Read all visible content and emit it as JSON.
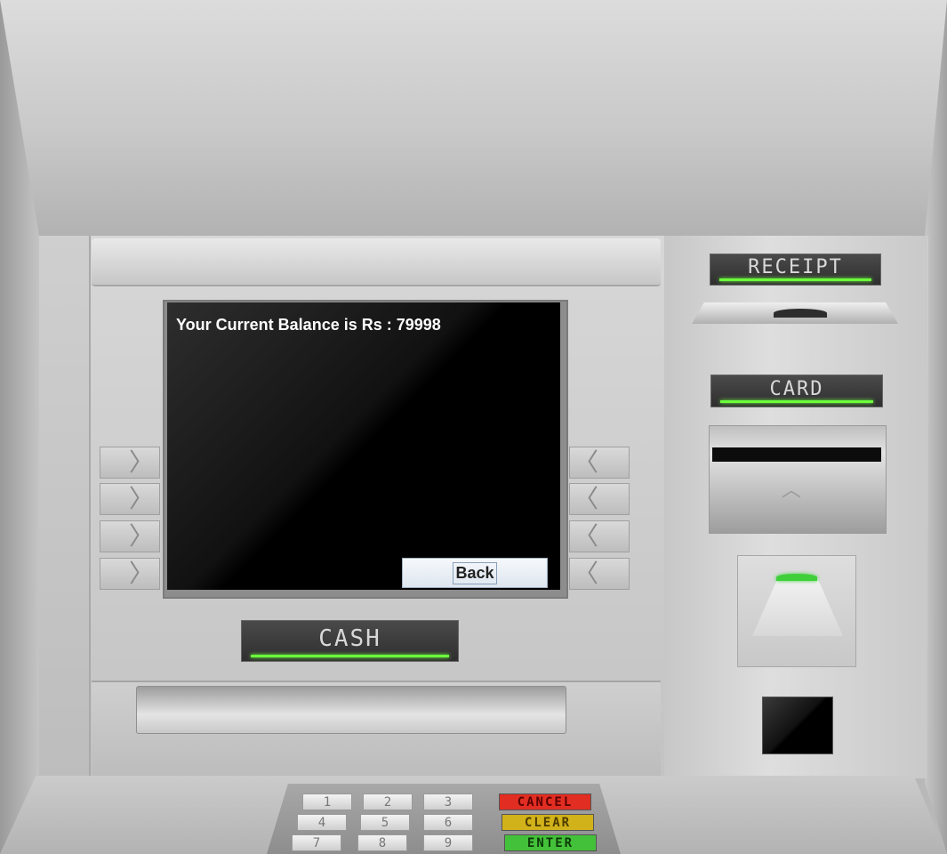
{
  "screen": {
    "balance_text": "Your Current Balance is Rs : 79998",
    "back_label": "Back"
  },
  "labels": {
    "receipt": "RECEIPT",
    "card": "CARD",
    "cash": "CASH"
  },
  "side_keys": {
    "left_glyph": "〉",
    "right_glyph": "〈"
  },
  "keypad": {
    "numbers": [
      "1",
      "2",
      "3",
      "4",
      "5",
      "6",
      "7",
      "8",
      "9"
    ],
    "cancel": "CANCEL",
    "clear": "CLEAR",
    "enter": "ENTER"
  },
  "colors": {
    "indicator_green": "#6cff3c",
    "cancel": "#e22d22",
    "clear": "#d1b21a",
    "enter": "#44c13a"
  }
}
